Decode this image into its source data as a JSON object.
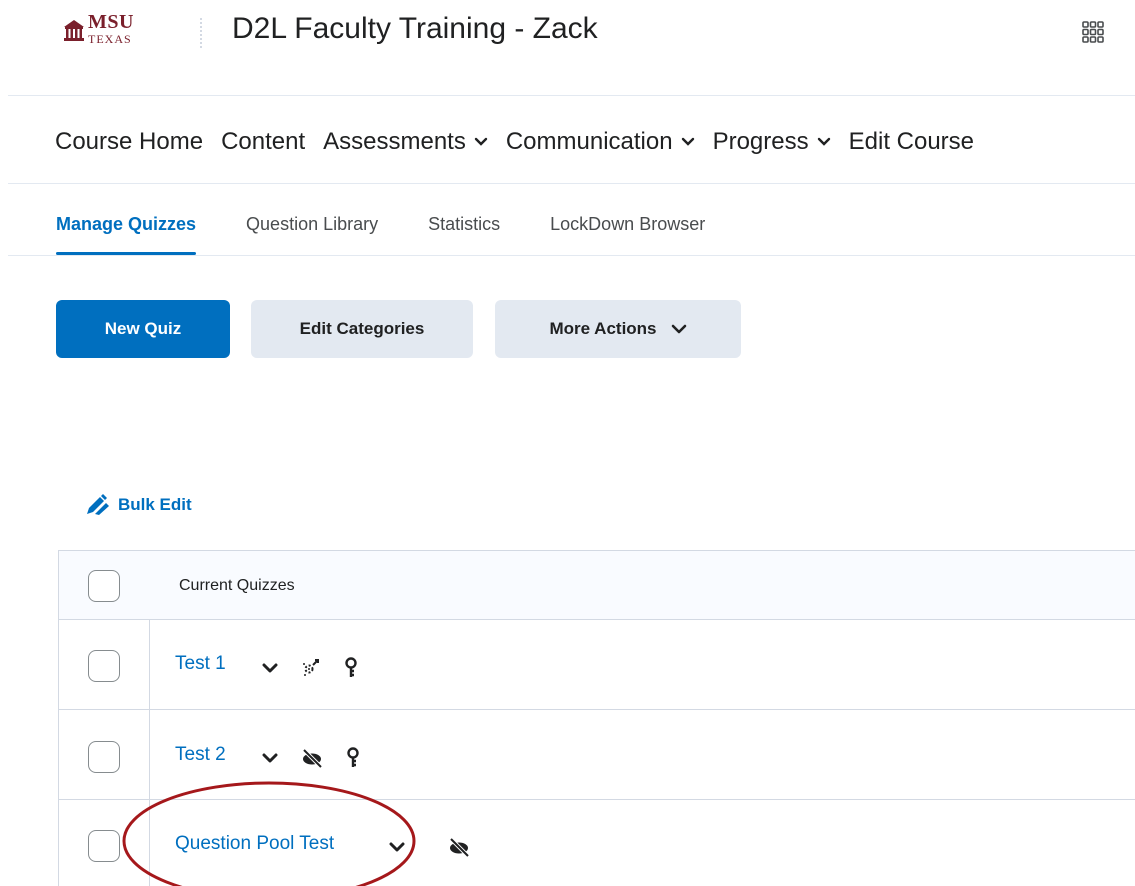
{
  "header": {
    "logo": {
      "main": "MSU",
      "sub": "TEXAS"
    },
    "course_title": "D2L Faculty Training - Zack",
    "apps_icon": "waffle-grid-icon"
  },
  "nav": {
    "items": [
      {
        "label": "Course Home",
        "dropdown": false
      },
      {
        "label": "Content",
        "dropdown": false
      },
      {
        "label": "Assessments",
        "dropdown": true
      },
      {
        "label": "Communication",
        "dropdown": true
      },
      {
        "label": "Progress",
        "dropdown": true
      },
      {
        "label": "Edit Course",
        "dropdown": false
      }
    ]
  },
  "tabs": [
    {
      "label": "Manage Quizzes",
      "active": true
    },
    {
      "label": "Question Library",
      "active": false
    },
    {
      "label": "Statistics",
      "active": false
    },
    {
      "label": "LockDown Browser",
      "active": false
    }
  ],
  "actions": {
    "new_quiz": "New Quiz",
    "edit_categories": "Edit Categories",
    "more_actions": "More Actions"
  },
  "bulk_edit": "Bulk Edit",
  "table": {
    "header": "Current Quizzes",
    "rows": [
      {
        "name": "Test 1",
        "icons": [
          "special-access-icon",
          "restrictions-icon"
        ]
      },
      {
        "name": "Test 2",
        "icons": [
          "hidden-icon",
          "restrictions-icon"
        ]
      },
      {
        "name": "Question Pool Test",
        "icons": [
          "hidden-icon"
        ]
      }
    ]
  },
  "colors": {
    "primary": "#006fbf",
    "annotation": "#a5181b",
    "brand": "#7a1f2b"
  }
}
